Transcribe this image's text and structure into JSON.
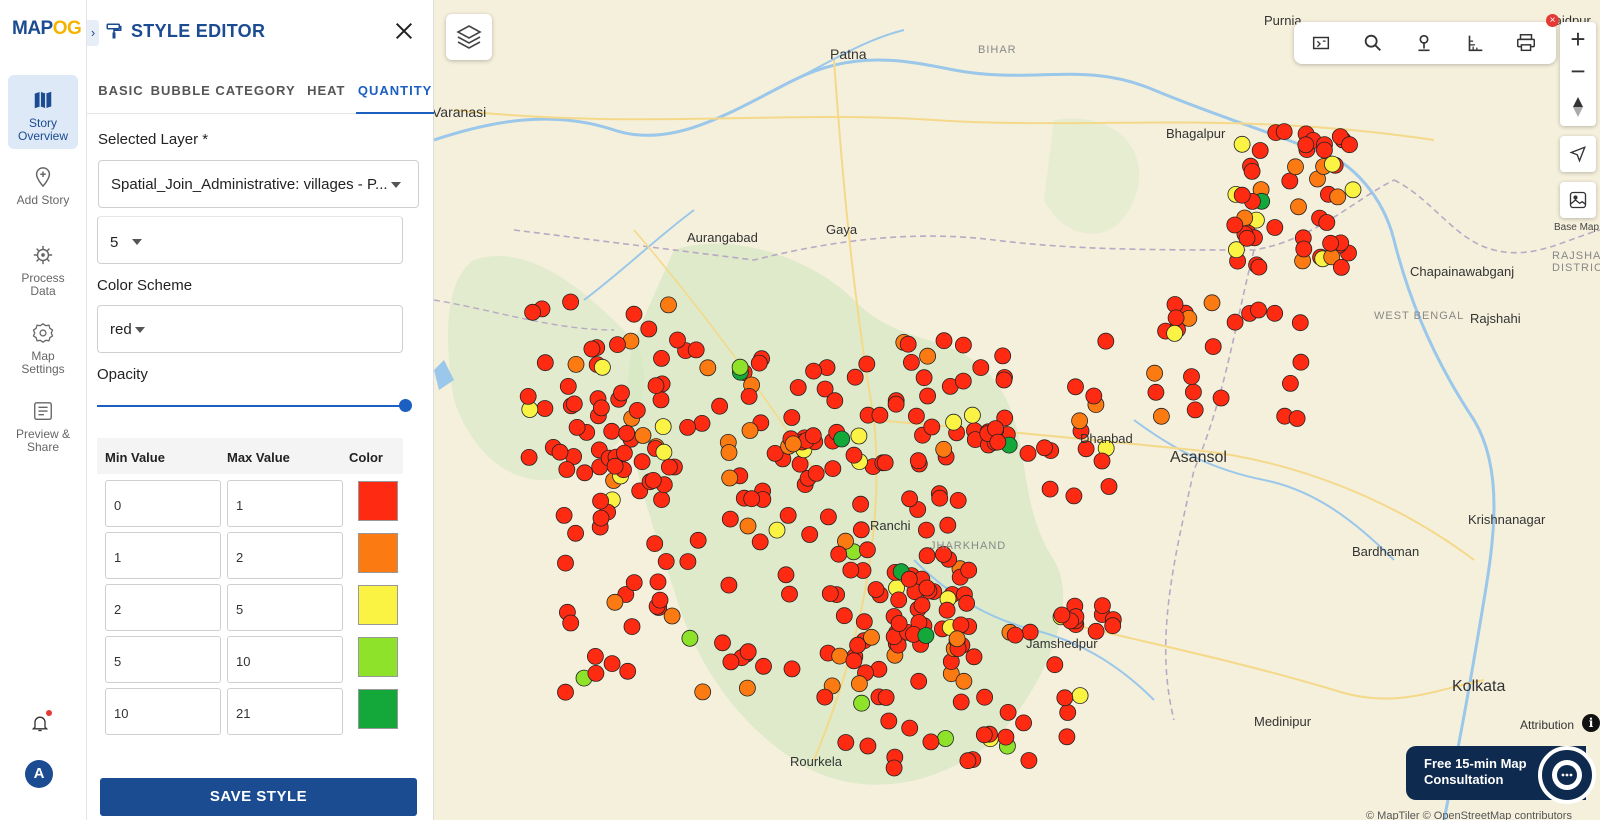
{
  "logo": {
    "part1": "MAP",
    "part2": "OG"
  },
  "nav": {
    "items": [
      {
        "label": "Story Overview",
        "icon": "map-icon",
        "active": true
      },
      {
        "label": "Add Story",
        "icon": "map-pin-plus-icon",
        "active": false
      },
      {
        "label": "Process Data",
        "icon": "gear-icon",
        "active": false
      },
      {
        "label": "Map Settings",
        "icon": "settings-icon",
        "active": false
      },
      {
        "label": "Preview & Share",
        "icon": "preview-icon",
        "active": false
      }
    ],
    "avatar_letter": "A"
  },
  "panel": {
    "title": "STYLE EDITOR",
    "tabs": [
      "BASIC",
      "BUBBLE",
      "CATEGORY",
      "HEAT",
      "QUANTITY"
    ],
    "active_tab": "QUANTITY",
    "selected_layer_label": "Selected Layer *",
    "selected_layer_value": "Spatial_Join_Administrative: villages - P...",
    "classes_value": "5",
    "color_scheme_label": "Color Scheme",
    "color_scheme_value": "red",
    "opacity_label": "Opacity",
    "opacity_value": 1.0,
    "table_headers": {
      "min": "Min Value",
      "max": "Max Value",
      "color": "Color"
    },
    "ranges": [
      {
        "min": "0",
        "max": "1",
        "color": "#ff2a12"
      },
      {
        "min": "1",
        "max": "2",
        "color": "#fb7a12"
      },
      {
        "min": "2",
        "max": "5",
        "color": "#fbf343"
      },
      {
        "min": "5",
        "max": "10",
        "color": "#8ee22a"
      },
      {
        "min": "10",
        "max": "21",
        "color": "#14a83a"
      }
    ],
    "save_label": "SAVE STYLE"
  },
  "map": {
    "cities": [
      "Patna",
      "Purnia",
      "Varanasi",
      "Bhagalpur",
      "Aurangabad",
      "Gaya",
      "Chapainawabganj",
      "Rajshahi",
      "Dhanbad",
      "Asansol",
      "Ranchi",
      "Jamshedpur",
      "Bardhaman",
      "Krishnanagar",
      "Rourkela",
      "Medinipur",
      "Kolkata",
      "Saidpur"
    ],
    "regions": [
      "BIHAR",
      "WEST BENGAL",
      "JHARKHAND",
      "RAJSHAHI DISTRICT"
    ],
    "basemap_label": "Base Map",
    "attribution_label": "Attribution",
    "consult_label": "Free 15-min Map Consultation",
    "copyright": "© MapTiler © OpenStreetMap contributors"
  }
}
